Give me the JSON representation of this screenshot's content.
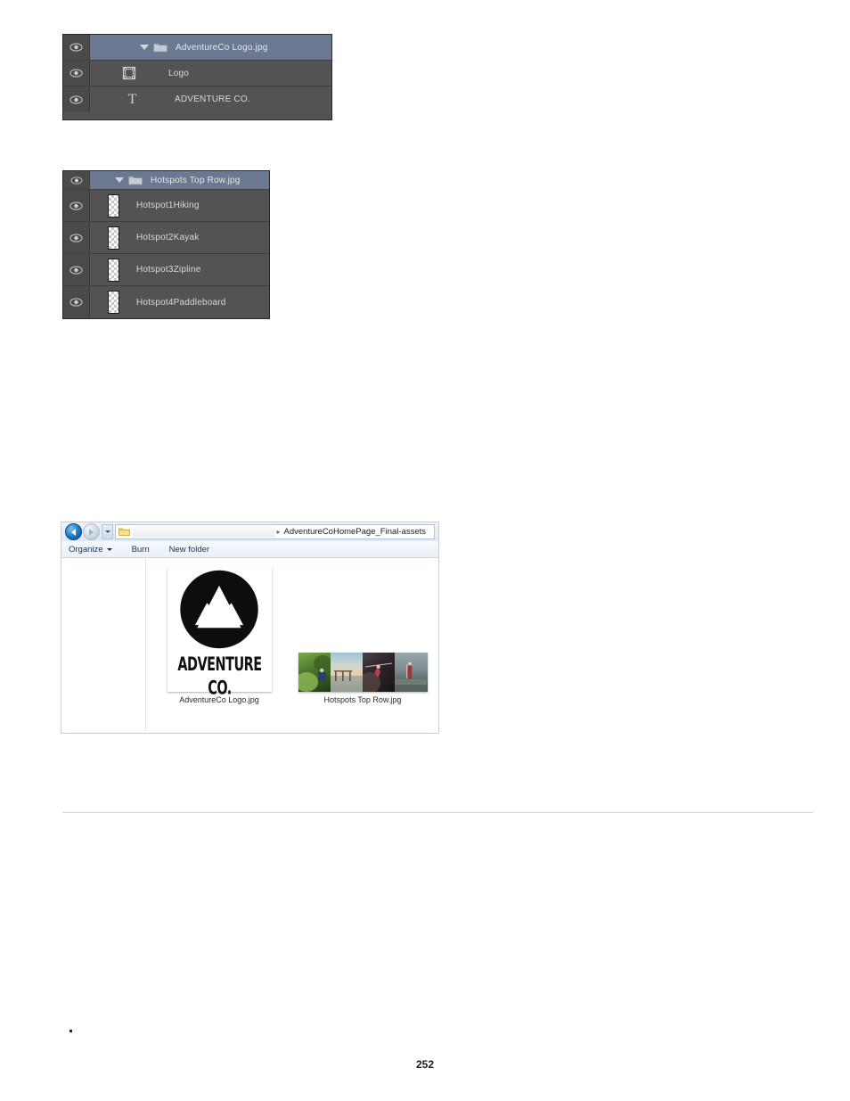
{
  "page": {
    "number": "252",
    "bullet_marker": "•"
  },
  "panels": [
    {
      "id": "logo-layers-panel",
      "name": "photoshop-layers-panel-logo",
      "rows": [
        {
          "label": "AdventureCo Logo.jpg",
          "kind": "group",
          "selected": true,
          "eye": "eye-icon",
          "icon": "folder-icon",
          "disclosure": "disclosure-triangle-down"
        },
        {
          "label": "Logo",
          "kind": "shape",
          "selected": false,
          "eye": "eye-icon",
          "icon": "vector-shape-icon"
        },
        {
          "label": "ADVENTURE CO.",
          "kind": "text",
          "selected": false,
          "eye": "eye-icon",
          "icon": "type-T-icon",
          "icon_glyph": "T"
        }
      ]
    },
    {
      "id": "hotspots-layers-panel",
      "name": "photoshop-layers-panel-hotspots",
      "rows": [
        {
          "label": "Hotspots Top Row.jpg",
          "kind": "group",
          "selected": true,
          "eye": "eye-icon",
          "icon": "folder-icon",
          "disclosure": "disclosure-triangle-down"
        },
        {
          "label": "Hotspot1Hiking",
          "kind": "pixel",
          "selected": false,
          "eye": "eye-icon",
          "icon": "transparency-thumbnail"
        },
        {
          "label": "Hotspot2Kayak",
          "kind": "pixel",
          "selected": false,
          "eye": "eye-icon",
          "icon": "transparency-thumbnail"
        },
        {
          "label": "Hotspot3Zipline",
          "kind": "pixel",
          "selected": false,
          "eye": "eye-icon",
          "icon": "transparency-thumbnail"
        },
        {
          "label": "Hotspot4Paddleboard",
          "kind": "pixel",
          "selected": false,
          "eye": "eye-icon",
          "icon": "transparency-thumbnail"
        }
      ]
    }
  ],
  "explorer": {
    "address": {
      "breadcrumb_separator": "▸",
      "path": "AdventureCoHomePage_Final-assets",
      "back_icon": "back-arrow-icon",
      "forward_icon": "forward-arrow-icon",
      "history_icon": "recent-pages-dropdown-icon",
      "folder_icon": "folder-icon"
    },
    "toolbar": {
      "organize": "Organize",
      "burn": "Burn",
      "new_folder": "New folder"
    },
    "files": [
      {
        "name": "AdventureCo Logo.jpg",
        "thumb": "adventureco-logo-thumbnail",
        "wordmark": "ADVENTURE CO."
      },
      {
        "name": "Hotspots Top Row.jpg",
        "thumb": "hotspots-top-row-thumbnail"
      }
    ]
  },
  "colors": {
    "panel_bg": "#535353",
    "panel_selected": "#6a7891",
    "panel_eyecell": "#4a4a4a",
    "panel_text": "#d8d8d8",
    "explorer_chrome": "#dfe8f2",
    "explorer_border": "#c4cfda",
    "rule": "#d6d6d6"
  }
}
